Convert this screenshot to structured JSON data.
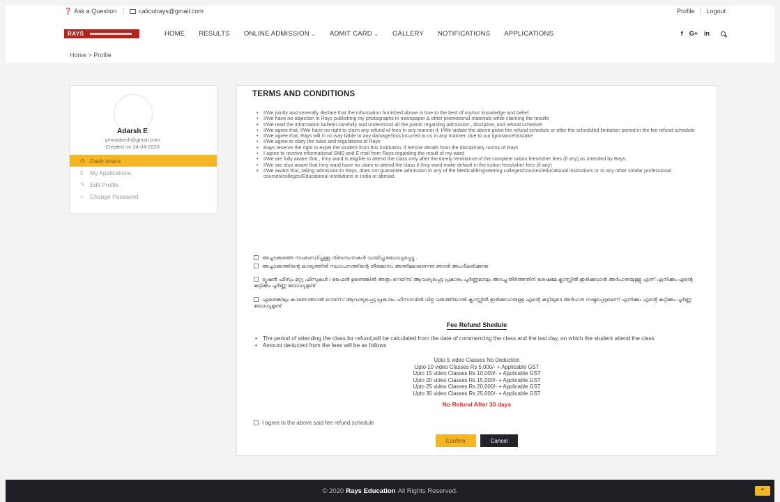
{
  "topbar": {
    "ask_label": "Ask a Question",
    "email": "calicutrays@gmail.com",
    "profile_link": "Profile",
    "logout_link": "Logout"
  },
  "nav": {
    "logo_text": "RAYS",
    "items": [
      "HOME",
      "RESULTS",
      "ONLINE ADMISSION",
      "ADMIT CARD",
      "GALLERY",
      "NOTIFICATIONS",
      "APPLICATIONS"
    ],
    "social": [
      "f",
      "G+",
      "in"
    ]
  },
  "breadcrumb": "Home > Profile",
  "profile": {
    "name": "Adarsh E",
    "email": "ymoadarsh@gmail.com",
    "created": "Created on  24-04-2020"
  },
  "menu": [
    {
      "label": "Dash board",
      "icon": "dashboard-icon",
      "active": true
    },
    {
      "label": "My Applications",
      "icon": "applications-icon",
      "active": false
    },
    {
      "label": "Edit Profile",
      "icon": "edit-icon",
      "active": false
    },
    {
      "label": "Change Password",
      "icon": "lock-icon",
      "active": false
    }
  ],
  "main": {
    "title": "TERMS AND CONDITIONS",
    "terms": [
      "I/We jointly and severally declare that the information furnished above is true to the best of my/our knowledge and belief.",
      "I/We have no objection in Rays publishing my photographs in newspaper & other promotional materials while claiming the results",
      "I/We read the information bulletin carefully and understood all the points regarding admission , discipline, and refund schedule",
      "I/We agree that, I/We have no right to claim any refund of fees in any manner if, I/We violate the above given fee refund schedule or after the scheduled limitation period in the fee refund schedule",
      "I/We agree that, Rays will in no way liable to any damage/loss incurred to us in any manner, due to our ignorance/mistake",
      "I/We agree to obey the rules and regulations of Rays",
      "Rays reserve the right to expel the student from this institution, if he/she derails from the disciplinary norms of Rays",
      "I agree to receive informational SMS and E mail from Rays regarding the result of my ward",
      "I/We are fully aware that , I/my ward is eligible to attend the class only after the timely remittance of the complete tuition fees/other fees (if any),as intended by Rays.",
      "I/We are also aware that I/my ward have no claim to attend the class if I/my ward make default in the tuition fees/other fees (if any)",
      "I/We aware that, taking admission in Rays, does not guarantee admission to any of the Medical/Engineering colleges/courses/educational institutions or to any other similar professional courses/colleges/Educational institutions in India or abroad."
    ],
    "malayalam": [
      "അച്ചടക്കത്തെ സംബന്ധിച്ചുള്ള നിബന്ധനകൾ വായിച്ചു ബോധ്യപ്പെട്ടു .",
      "അച്ചടക്കത്തിന്റെ കാര്യത്തിൽ സ്ഥാപനത്തിന്റെ തീരുമാനം അന്തിമമാണെന്നു      ഞാൻ അംഗീകരിക്കുന്നു",
      "ട്യൂഷൻ ഫീസും മറ്റു ഫീസുകൾ / ഫൈൻ ഉണ്ടെങ്കിൽ അതും റെയ്‌സ് ആവശ്യപ്പെട്ട പ്രകാരം പൂർണ്ണമായും അടച്ചു തീർത്തതിന് ശേഷമേ ക്ലാസ്സിൽ ഇരിക്കുവാൻ അർഹതയുള്ളു എന്ന് എനിക്കും എന്റെ കുട്ടിക്കും പൂർണ്ണ ബോധ്യമുണ്ട് .",
      "ഏതെങ്കിലും കാരണത്താൽ റെയ്‌സ് ആവശ്യപ്പെട്ട പ്രകാരം ഫീസടവിൽ വീഴ്ച വരുത്തിയാൽ ക്ലാസ്സിൽ ഇരിക്കുവാനുള്ള എന്റെ കുട്ടിയുടെ അർഹത നഷ്ടപ്പെടുമെന്ന് എനിക്കും എന്റെ കുട്ടിക്കും പൂർണ്ണ ബോധ്യമുണ്ട്"
    ],
    "fee_title": "Fee Refund Shedule",
    "fee_para1": "The period of attending the class,for refund,will be calculated from the date of commencing the class and the last day, on which the student attend the class",
    "fee_para2": "Amount deducted from the fees will be as follows",
    "deductions": [
      "Upto 5 video Classes No Deduction",
      "Upto 10 video Classes Rs 5,000/- + Applicable GST",
      "Upto 15 video Classes Rs 10,000/- + Applicable GST",
      "Upto 20 video Classes Rs 15,000/- + Applicable GST",
      "Upto 25 video Classes Rs 20,000/- + Applicable GST",
      "Upto 30 video Classes Rs 25,000/- + Applicable GST"
    ],
    "no_refund": "No Refund After 30 days",
    "agree_label": "I agree to the above said fee refund schedule",
    "confirm_label": "Confirm",
    "cancel_label": "Cancel"
  },
  "footer": {
    "prefix": "© 2020",
    "brand": "Rays Education",
    "suffix": "All Rights Reserved."
  },
  "colors": {
    "accent": "#f5b626",
    "brand_red": "#b2251f",
    "footer_bg": "#1f2026",
    "alert_red": "#e5292a"
  }
}
